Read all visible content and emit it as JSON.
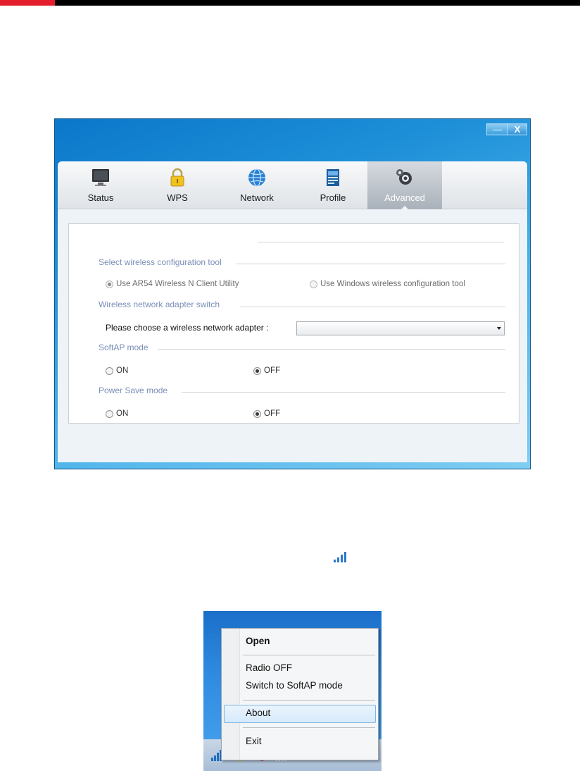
{
  "window": {
    "controls": {
      "minimize_label": "—",
      "close_label": "X"
    },
    "tabs": [
      {
        "label": "Status",
        "icon": "monitor-icon"
      },
      {
        "label": "WPS",
        "icon": "padlock-icon"
      },
      {
        "label": "Network",
        "icon": "globe-icon"
      },
      {
        "label": "Profile",
        "icon": "document-icon"
      },
      {
        "label": "Advanced",
        "icon": "gear-icon",
        "active": true
      }
    ]
  },
  "advanced": {
    "config_tool_title": "Select wireless configuration tool",
    "config_option_utility": "Use AR54 Wireless N Client Utility",
    "config_option_windows": "Use Windows wireless configuration tool",
    "adapter_switch_title": "Wireless network adapter switch",
    "adapter_label": "Please choose a wireless network adapter :",
    "adapter_value": "",
    "softap_title": "SoftAP mode",
    "softap_on": "ON",
    "softap_off": "OFF",
    "softap_selected": "OFF",
    "powersave_title": "Power Save mode",
    "powersave_on": "ON",
    "powersave_off": "OFF",
    "powersave_selected": "OFF"
  },
  "tray_menu": {
    "items": [
      "Open",
      "Radio OFF",
      "Switch to SoftAP mode",
      "About",
      "Exit"
    ],
    "highlighted": "About"
  },
  "colors": {
    "header_red": "#e41d2b",
    "section_title": "#7a8fb8",
    "window_blue": "#1d8fd8"
  }
}
